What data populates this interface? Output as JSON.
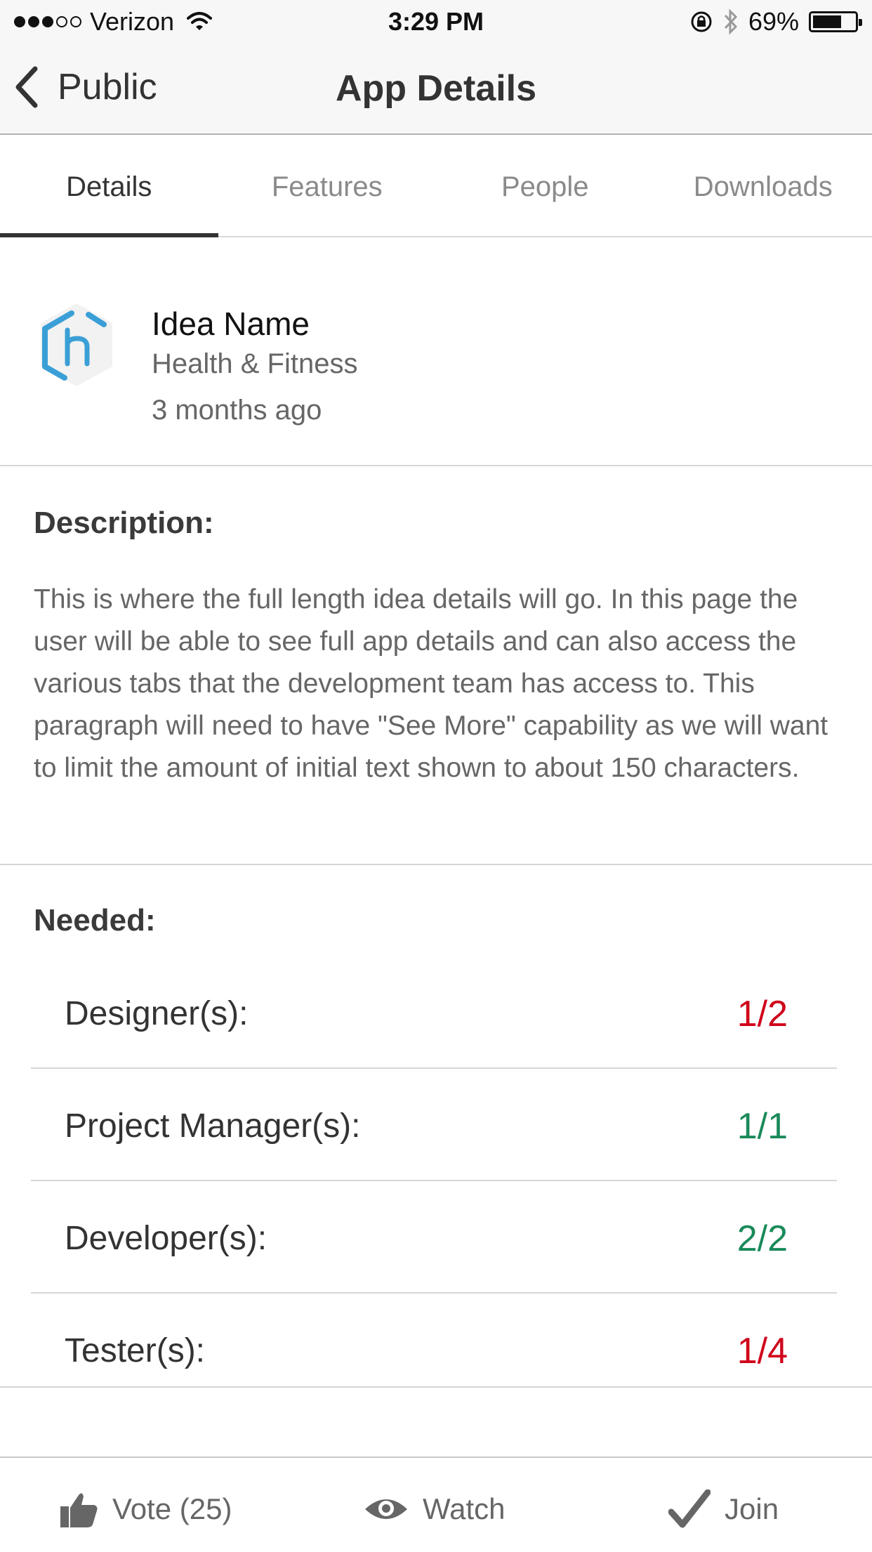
{
  "status_bar": {
    "carrier": "Verizon",
    "time": "3:29 PM",
    "battery_text": "69%",
    "battery_level": 0.69,
    "signal_bars_filled": 3,
    "signal_bars_total": 5
  },
  "nav": {
    "back_label": "Public",
    "title": "App Details"
  },
  "tabs": [
    {
      "label": "Details",
      "active": true
    },
    {
      "label": "Features",
      "active": false
    },
    {
      "label": "People",
      "active": false
    },
    {
      "label": "Downloads",
      "active": false
    }
  ],
  "app": {
    "name": "Idea Name",
    "category": "Health & Fitness",
    "posted": "3 months ago",
    "logo_icon": "hexagon-h-logo",
    "logo_color": "#3a9fd6"
  },
  "description": {
    "title": "Description:",
    "text": "This is where the full length idea details will go. In this page the user will be able to see full app details and can also access the various tabs that the development team has access to. This paragraph will need to have \"See More\" capability as we will want to limit the amount of initial text shown to about 150 characters."
  },
  "needed": {
    "title": "Needed:",
    "roles": [
      {
        "label": "Designer(s):",
        "count": "1/2",
        "color": "#d0021b"
      },
      {
        "label": "Project Manager(s):",
        "count": "1/1",
        "color": "#1a8a5a"
      },
      {
        "label": "Developer(s):",
        "count": "2/2",
        "color": "#1a8a5a"
      },
      {
        "label": "Tester(s):",
        "count": "1/4",
        "color": "#d0021b"
      }
    ]
  },
  "toolbar": {
    "vote_label": "Vote (25)",
    "watch_label": "Watch",
    "join_label": "Join"
  }
}
